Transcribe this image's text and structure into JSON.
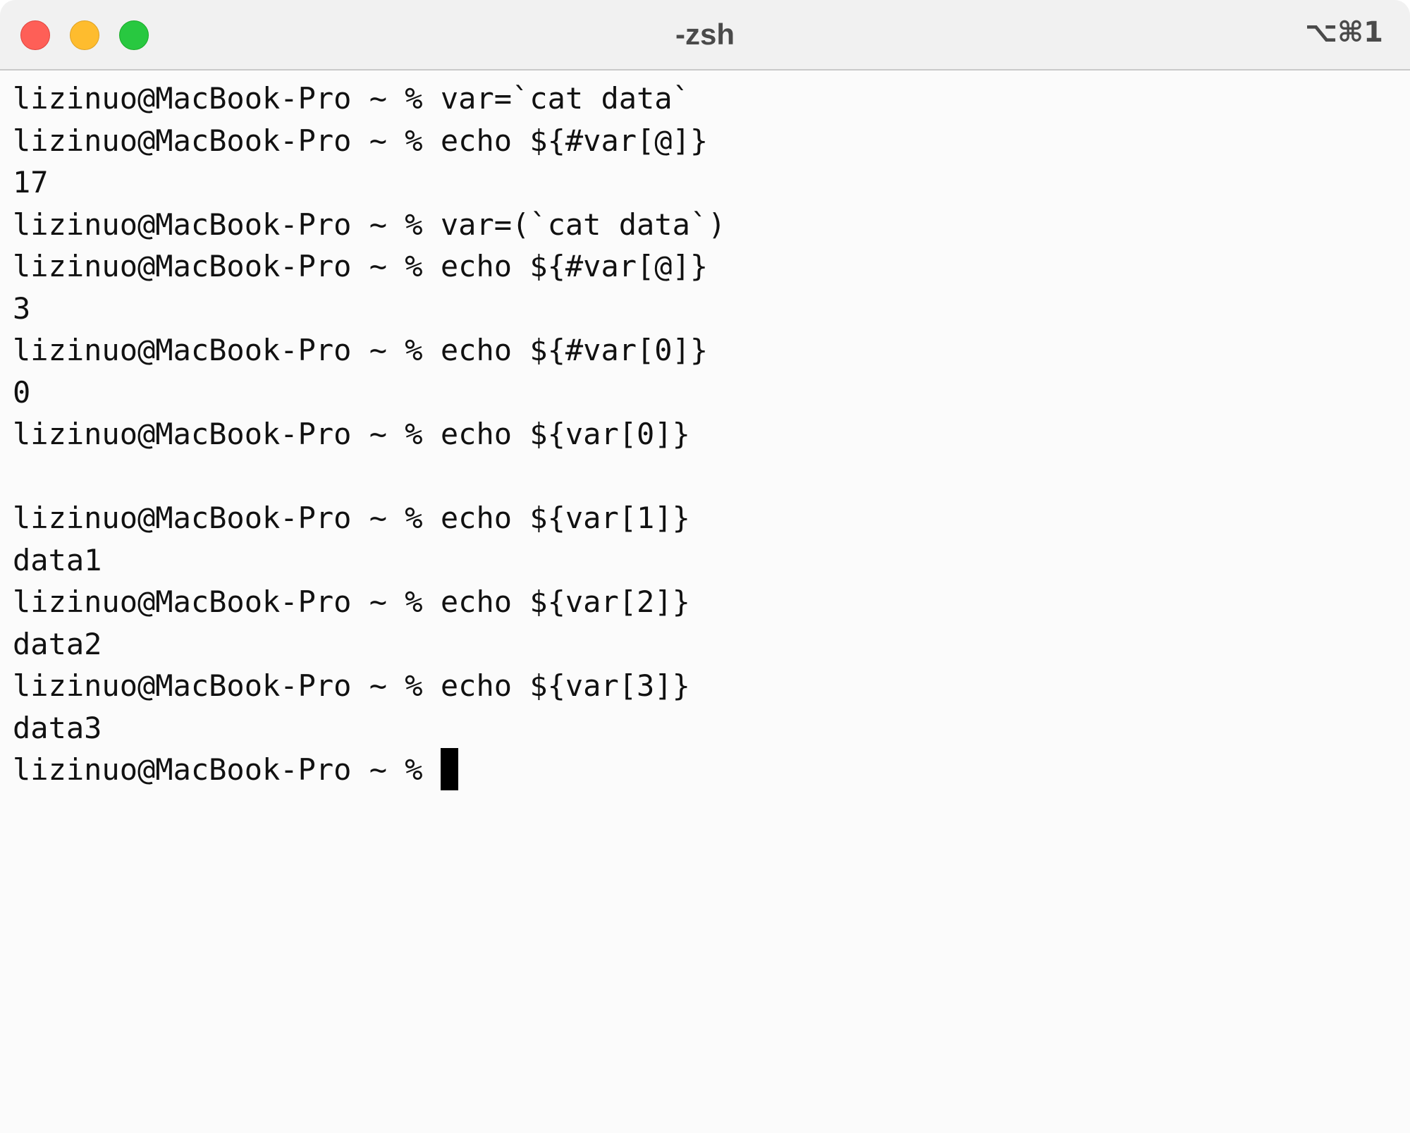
{
  "window": {
    "title": "-zsh",
    "shortcut": "⌥⌘1"
  },
  "terminal": {
    "prompt": "lizinuo@MacBook-Pro ~ % ",
    "lines": [
      "lizinuo@MacBook-Pro ~ % var=`cat data`",
      "lizinuo@MacBook-Pro ~ % echo ${#var[@]}",
      "17",
      "lizinuo@MacBook-Pro ~ % var=(`cat data`)",
      "lizinuo@MacBook-Pro ~ % echo ${#var[@]}",
      "3",
      "lizinuo@MacBook-Pro ~ % echo ${#var[0]}",
      "0",
      "lizinuo@MacBook-Pro ~ % echo ${var[0]}",
      "",
      "lizinuo@MacBook-Pro ~ % echo ${var[1]}",
      "data1",
      "lizinuo@MacBook-Pro ~ % echo ${var[2]}",
      "data2",
      "lizinuo@MacBook-Pro ~ % echo ${var[3]}",
      "data3"
    ]
  },
  "colors": {
    "close": "#fe5f57",
    "minimize": "#febc2e",
    "zoom": "#28c840",
    "background": "#fbfbfb",
    "text": "#111111",
    "cursor": "#000000"
  }
}
